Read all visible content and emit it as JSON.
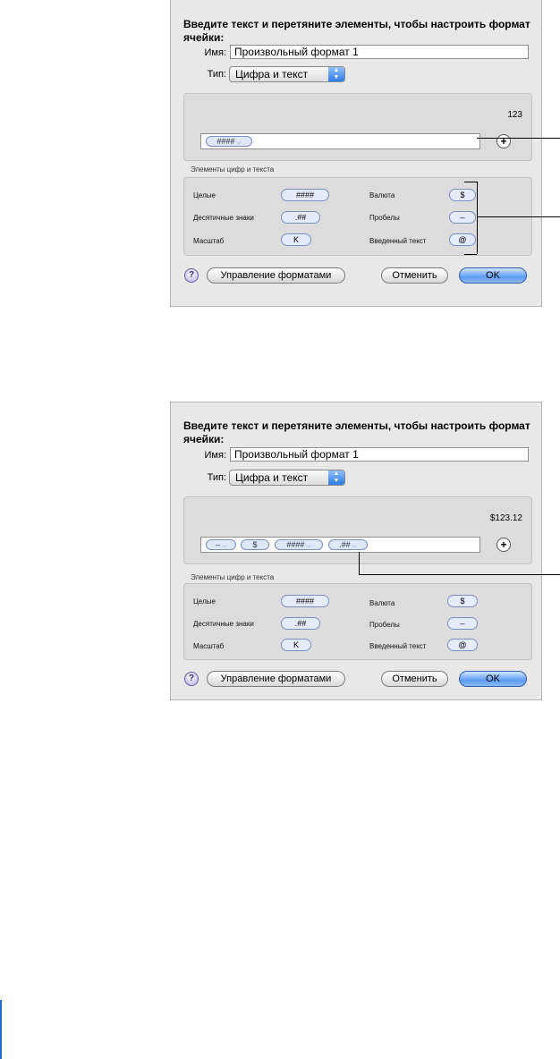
{
  "dialog1": {
    "instruction": "Введите текст и перетяните элементы, чтобы настроить формат ячейки:",
    "name_label": "Имя:",
    "name_value": "Произвольный формат 1",
    "type_label": "Тип:",
    "type_value": "Цифра и текст",
    "preview": "123",
    "format_tokens": [
      "####"
    ],
    "elements_title": "Элементы цифр и текста",
    "elements": {
      "integers_label": "Целые",
      "integers_token": "####",
      "decimals_label": "Десятичные знаки",
      "decimals_token": ".##",
      "scale_label": "Масштаб",
      "scale_token": "K",
      "currency_label": "Валюта",
      "currency_token": "$",
      "spaces_label": "Пробелы",
      "spaces_token": "–",
      "text_label": "Введенный текст",
      "text_token": "@"
    },
    "help": "?",
    "manage_button": "Управление форматами",
    "cancel_button": "Отменить",
    "ok_button": "OK"
  },
  "dialog2": {
    "instruction": "Введите текст и перетяните элементы, чтобы настроить формат ячейки:",
    "name_label": "Имя:",
    "name_value": "Произвольный формат 1",
    "type_label": "Тип:",
    "type_value": "Цифра и текст",
    "preview": "$123.12",
    "format_tokens": [
      "–",
      "$",
      "####",
      ".##"
    ],
    "elements_title": "Элементы цифр и текста",
    "elements": {
      "integers_label": "Целые",
      "integers_token": "####",
      "decimals_label": "Десятичные знаки",
      "decimals_token": ".##",
      "scale_label": "Масштаб",
      "scale_token": "K",
      "currency_label": "Валюта",
      "currency_token": "$",
      "spaces_label": "Пробелы",
      "spaces_token": "–",
      "text_label": "Введенный текст",
      "text_token": "@"
    },
    "help": "?",
    "manage_button": "Управление форматами",
    "cancel_button": "Отменить",
    "ok_button": "OK"
  },
  "icons": {
    "plus": "plus-circle-icon",
    "help": "help-icon",
    "popup_arrows": "updown-arrows-icon",
    "token_dropdown": "chevron-down-icon"
  },
  "colors": {
    "dialog_bg": "#e8e8e8",
    "token_bg": "#e4ebfb",
    "default_button": "#5d9cf0"
  }
}
